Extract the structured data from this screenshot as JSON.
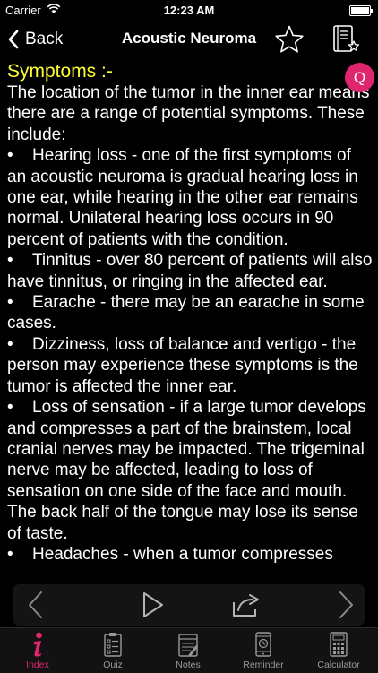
{
  "status_bar": {
    "carrier": "Carrier",
    "time": "12:23 AM"
  },
  "nav": {
    "back_label": "Back",
    "title": "Acoustic Neuroma",
    "favorite_icon": "star-icon",
    "bookmark_icon": "bookmark-list-icon"
  },
  "content": {
    "heading": "Symptoms :-",
    "intro": "The location of the tumor in the inner ear means there are a range of potential symptoms. These include:",
    "bullet_symbol": "•",
    "bullets": [
      "Hearing loss - one of the first symptoms of an acoustic neuroma is gradual hearing loss in one ear, while hearing in the other ear remains normal. Unilateral hearing loss occurs in 90 percent of patients with the condition.",
      "Tinnitus - over 80 percent of patients will also have tinnitus, or ringing in the affected ear.",
      "Earache - there may be an earache in some cases.",
      "Dizziness, loss of balance and vertigo - the person may experience these symptoms is the tumor is affected the inner ear.",
      "Loss of sensation - if a large tumor develops and compresses a part of the brainstem, local cranial nerves may be impacted. The trigeminal nerve may be affected, leading to loss of sensation on one side of the face and mouth. The back half of the tongue may lose its sense of taste.",
      "Headaches - when a tumor compresses"
    ],
    "quiz_button_label": "Q"
  },
  "pager": {
    "prev_icon": "chevron-left-icon",
    "play_icon": "play-icon",
    "share_icon": "share-icon",
    "next_icon": "chevron-right-icon"
  },
  "tabs": [
    {
      "label": "Index",
      "icon": "info-icon",
      "active": true
    },
    {
      "label": "Quiz",
      "icon": "quiz-clipboard-icon",
      "active": false
    },
    {
      "label": "Notes",
      "icon": "notes-icon",
      "active": false
    },
    {
      "label": "Reminder",
      "icon": "reminder-phone-icon",
      "active": false
    },
    {
      "label": "Calculator",
      "icon": "calculator-icon",
      "active": false
    }
  ],
  "colors": {
    "background": "#000000",
    "heading": "#ffff33",
    "accent": "#e0256f",
    "tab_inactive": "#9a9a9a"
  }
}
